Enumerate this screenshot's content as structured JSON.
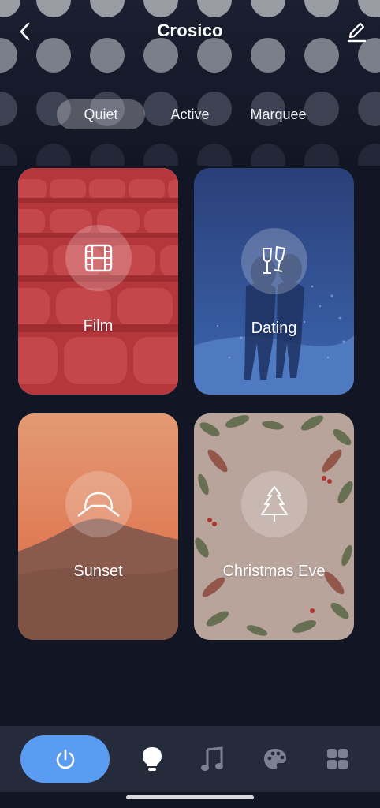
{
  "header": {
    "title": "Crosico",
    "back_icon": "chevron-left-icon",
    "edit_icon": "pencil-icon"
  },
  "tabs": [
    {
      "label": "Quiet",
      "active": true
    },
    {
      "label": "Active",
      "active": false
    },
    {
      "label": "Marquee",
      "active": false
    }
  ],
  "scenes": [
    {
      "label": "Film",
      "icon": "film-icon",
      "selected": true,
      "color": "#b5363b"
    },
    {
      "label": "Dating",
      "icon": "champagne-glasses-icon",
      "selected": false,
      "color": "#2c4f8f"
    },
    {
      "label": "Sunset",
      "icon": "sunset-icon",
      "selected": false,
      "color": "#d98a6c"
    },
    {
      "label": "Christmas Eve",
      "icon": "christmas-tree-icon",
      "selected": false,
      "color": "#b7a39c"
    }
  ],
  "bottom_nav": [
    {
      "icon": "power-icon",
      "active": true
    },
    {
      "icon": "bulb-icon",
      "active": false
    },
    {
      "icon": "music-icon",
      "active": false
    },
    {
      "icon": "palette-icon",
      "active": false
    },
    {
      "icon": "grid-icon",
      "active": false
    }
  ],
  "colors": {
    "background": "#121624",
    "accent": "#5b9cf3",
    "bottom_bar": "#262b3c"
  }
}
